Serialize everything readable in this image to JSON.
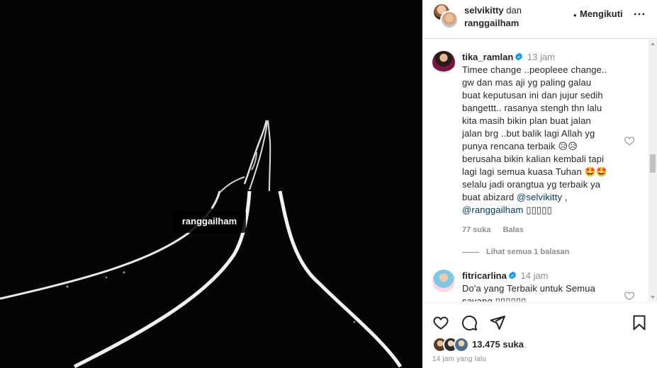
{
  "photo": {
    "tag_label": "ranggailham"
  },
  "header": {
    "user1": "selvikitty",
    "and_word": "dan",
    "user2": "ranggailham",
    "dot": "•",
    "follow_label": "Mengikuti"
  },
  "comments": [
    {
      "username": "tika_ramlan",
      "time": "13 jam",
      "text": "Timee change ..peopleee change..\ngw dan mas aji yg paling galau\nbuat keputusan ini dan jujur sedih\nbangettt.. rasanya stengh thn lalu\nkita masih bikin plan buat jalan\njalan brg ..but balik lagi Allah yg\npunya rencana terbaik 😥😥\nberusaha bikin kalian kembali tapi\nlagi lagi semua kuasa Tuhan 🤩🤩\nselalu jadi orangtua yg terbaik ya\nbuat abizard ",
      "mention1": "@selvikitty",
      "sep": " ,",
      "mention2": "@ranggailham",
      "trail": " ▯▯▯▯▯",
      "likes": "77 suka",
      "reply": "Balas"
    },
    {
      "username": "fitricarlina",
      "time": "14 jam",
      "text": "Do'a yang Terbaik untuk Semua\nsayang ▯▯▯▯▯▯"
    }
  ],
  "view_replies": "Lihat semua 1 balasan",
  "footer": {
    "likes_count": "13.475 suka",
    "time_ago": "14 jam yang lalu"
  },
  "icons": {
    "like": "heart-icon",
    "comment": "comment-icon",
    "share": "paper-plane-icon",
    "save": "bookmark-icon",
    "more": "more-icon",
    "verified": "verified-badge-icon"
  },
  "colors": {
    "verified_blue": "#0095f6",
    "mention": "#00376b",
    "muted": "#8e8e8e"
  }
}
